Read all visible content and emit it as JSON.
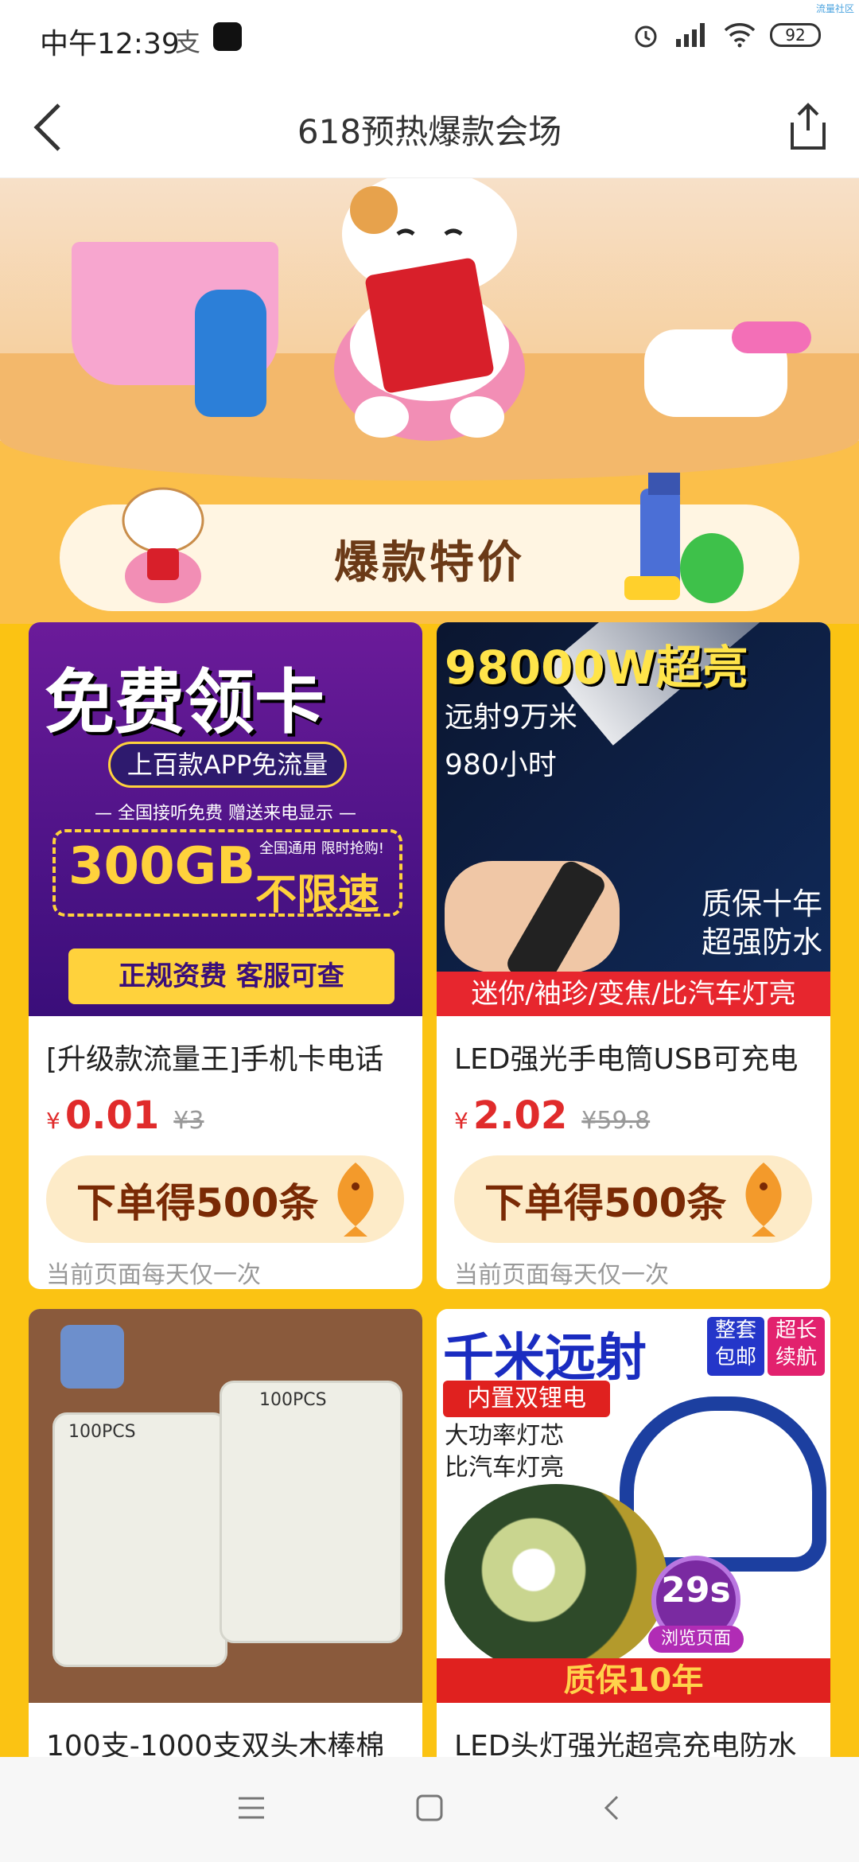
{
  "status_bar": {
    "time": "中午12:39",
    "ali_glyph": "支",
    "battery": "92",
    "watermark": "流量社区"
  },
  "header": {
    "title": "618预热爆款会场"
  },
  "banner": {
    "title": "爆款特价"
  },
  "products": [
    {
      "name": "[升级款流量王]手机卡电话",
      "price": "0.01",
      "original_price": "¥3",
      "reward": "下单得500条",
      "note": "当前页面每天仅一次",
      "image": {
        "headline": "免费领卡",
        "pill": "上百款APP免流量",
        "line": "— 全国接听免费 赠送来电显示 —",
        "gb": "300GB",
        "gb_note": "全国通用 限时抢购!",
        "gb_speed": "不限速",
        "footer": "正规资费 客服可查"
      }
    },
    {
      "name": "LED强光手电筒USB可充电",
      "price": "2.02",
      "original_price": "¥59.8",
      "reward": "下单得500条",
      "note": "当前页面每天仅一次",
      "image": {
        "headline": "98000W超亮",
        "line1": "远射9万米",
        "line2": "980小时",
        "quality": "质保十年",
        "waterproof": "超强防水",
        "footer": "迷你/袖珍/变焦/比汽车灯亮"
      }
    },
    {
      "name": "100支-1000支双头木棒棉",
      "image": {
        "pack_label": "100PCS"
      }
    },
    {
      "name": "LED头灯强光超亮充电防水",
      "image": {
        "headline": "千米远射",
        "tag1": "整套包邮",
        "tag2": "超长续航",
        "red_tag": "内置双锂电",
        "line1": "大功率灯芯",
        "line2": "比汽车灯亮",
        "timer_value": "29s",
        "timer_label": "浏览页面",
        "footer": "质保10年"
      }
    }
  ],
  "currency_symbol": "¥",
  "icons": {
    "back": "chevron-left-icon",
    "share": "share-icon",
    "menu": "menu-icon",
    "home": "home-icon",
    "nav_back": "nav-back-icon"
  },
  "colors": {
    "page_bg": "#fbc313",
    "price": "#e02b2b",
    "reward_bg": "#fdebc8"
  }
}
